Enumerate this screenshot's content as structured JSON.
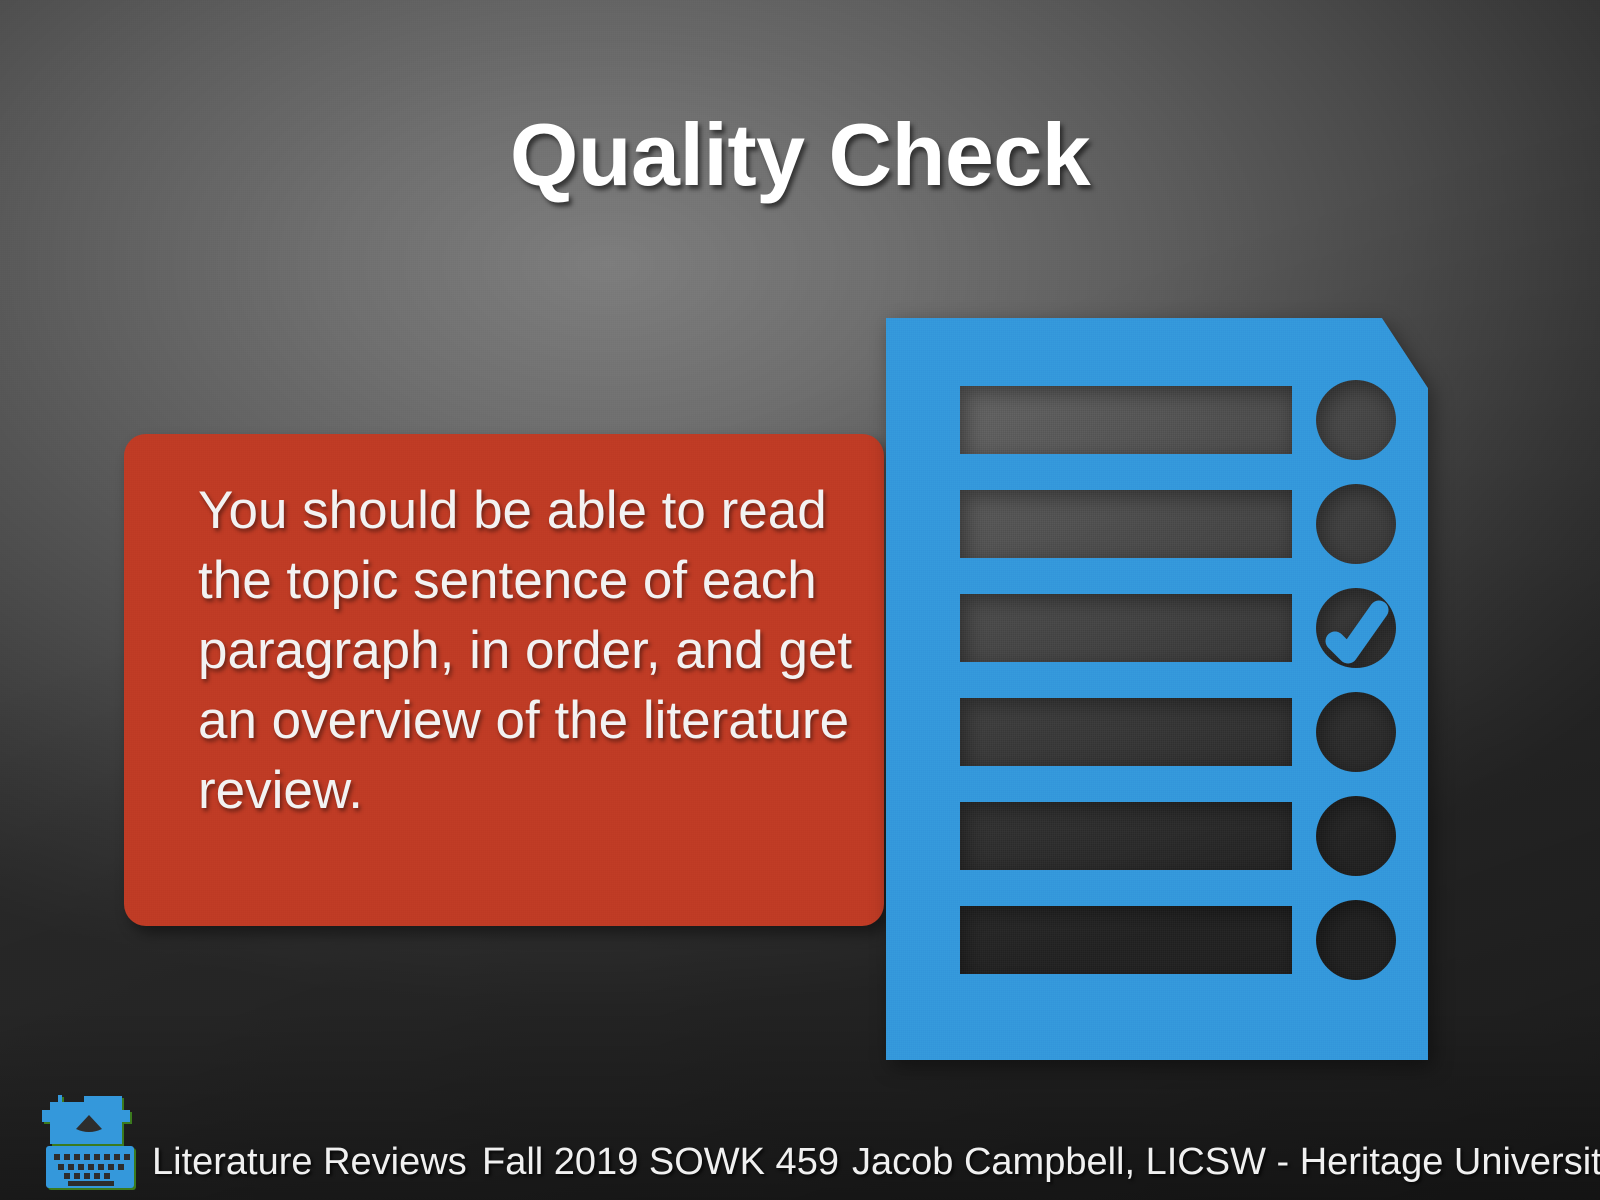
{
  "slide": {
    "title": "Quality Check",
    "background_color": "#5d5d5d",
    "accent_red": "#bf3b25",
    "accent_blue": "#3498db",
    "logo_outline_green": "#3b7a1e"
  },
  "callout": {
    "body": "You should be able to read the topic sentence of each paragraph, in order, and get an overview of the literature review.",
    "background_color": "#bf3b25",
    "text_color": "#f2f2f2"
  },
  "graphic": {
    "name": "checklist-graphic",
    "description": "Checklist with six line rows and six checkboxes; third checkbox is checked",
    "color": "#3498db",
    "rows": [
      {
        "index": 1,
        "checked": false
      },
      {
        "index": 2,
        "checked": false
      },
      {
        "index": 3,
        "checked": true
      },
      {
        "index": 4,
        "checked": false
      },
      {
        "index": 5,
        "checked": false
      },
      {
        "index": 6,
        "checked": false
      }
    ],
    "checked_count": 1,
    "total_count": 6
  },
  "footer": {
    "logo_icon": "typewriter-icon",
    "course": "Literature Reviews",
    "term": "Fall 2019 SOWK 459",
    "author": "Jacob Campbell, LICSW - Heritage University"
  }
}
